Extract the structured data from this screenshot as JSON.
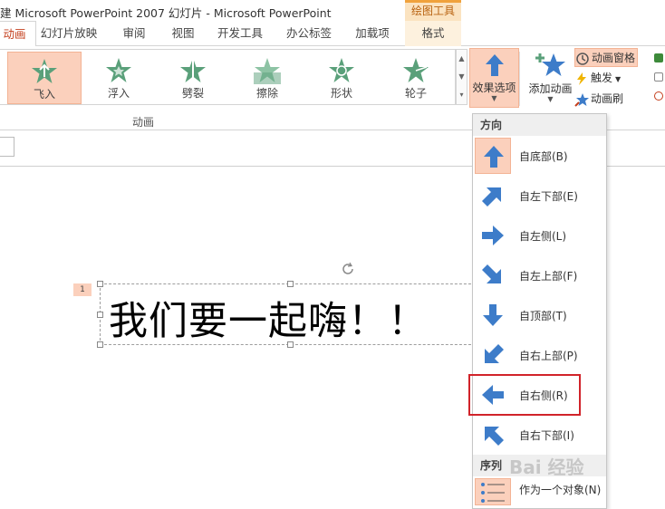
{
  "window": {
    "title": "建 Microsoft PowerPoint 2007 幻灯片 - Microsoft PowerPoint",
    "contextual_group": "绘图工具"
  },
  "tabs": [
    {
      "label": "动画",
      "active": true
    },
    {
      "label": "幻灯片放映"
    },
    {
      "label": "审阅"
    },
    {
      "label": "视图"
    },
    {
      "label": "开发工具"
    },
    {
      "label": "办公标签"
    },
    {
      "label": "加载项"
    },
    {
      "label": "格式",
      "contextual": true
    }
  ],
  "ribbon": {
    "gallery": [
      {
        "label": "飞入",
        "selected": true
      },
      {
        "label": "浮入"
      },
      {
        "label": "劈裂"
      },
      {
        "label": "擦除"
      },
      {
        "label": "形状"
      },
      {
        "label": "轮子"
      }
    ],
    "group_label": "动画",
    "effect_options_label": "效果选项",
    "add_animation_label": "添加动画",
    "animation_pane_label": "动画窗格",
    "trigger_label": "触发",
    "painter_label": "动画刷"
  },
  "slide": {
    "anim_order": "1",
    "text": "我们要一起嗨！！"
  },
  "dropdown": {
    "direction_header": "方向",
    "items": [
      {
        "label": "自底部(B)",
        "icon": "arrow-up-icon"
      },
      {
        "label": "自左下部(E)",
        "icon": "arrow-up-right-icon"
      },
      {
        "label": "自左侧(L)",
        "icon": "arrow-right-icon"
      },
      {
        "label": "自左上部(F)",
        "icon": "arrow-down-right-icon"
      },
      {
        "label": "自顶部(T)",
        "icon": "arrow-down-icon"
      },
      {
        "label": "自右上部(P)",
        "icon": "arrow-down-left-icon"
      },
      {
        "label": "自右侧(R)",
        "icon": "arrow-left-icon"
      },
      {
        "label": "自右下部(I)",
        "icon": "arrow-up-left-icon"
      }
    ],
    "sequence_header": "序列",
    "sequence_item": "作为一个对象(N)"
  },
  "colors": {
    "accent": "#c43e1c",
    "selection_fill": "#fbd0bc",
    "arrow_blue": "#3d7cc9",
    "star_green": "#5aa07a",
    "highlight_box": "#d1232a"
  },
  "watermark": "Bai 经验"
}
